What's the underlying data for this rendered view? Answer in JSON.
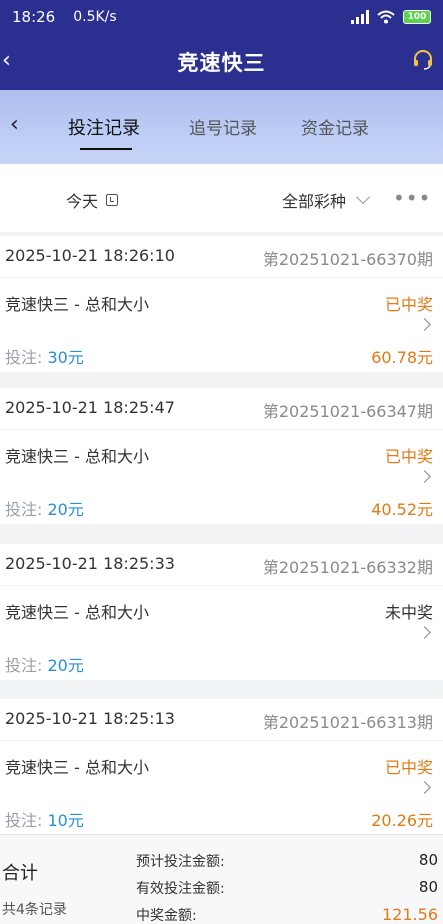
{
  "status_bar": {
    "time": "18:26",
    "net_speed": "0.5K/s",
    "battery": "100"
  },
  "app_bar": {
    "title": "竞速快三"
  },
  "tabs": [
    {
      "label": "投注记录",
      "active": true
    },
    {
      "label": "追号记录",
      "active": false
    },
    {
      "label": "资金记录",
      "active": false
    }
  ],
  "filter": {
    "date": "今天",
    "lottery": "全部彩种",
    "more": "•••"
  },
  "records": [
    {
      "datetime": "2025-10-21 18:26:10",
      "period": "第20251021-66370期",
      "name": "竞速快三 - 总和大小",
      "status": "已中奖",
      "bet_label": "投注:",
      "bet": "30元",
      "prize": "60.78元",
      "won": true
    },
    {
      "datetime": "2025-10-21 18:25:47",
      "period": "第20251021-66347期",
      "name": "竞速快三 - 总和大小",
      "status": "已中奖",
      "bet_label": "投注:",
      "bet": "20元",
      "prize": "40.52元",
      "won": true
    },
    {
      "datetime": "2025-10-21 18:25:33",
      "period": "第20251021-66332期",
      "name": "竞速快三 - 总和大小",
      "status": "未中奖",
      "bet_label": "投注:",
      "bet": "20元",
      "prize": "",
      "won": false
    },
    {
      "datetime": "2025-10-21 18:25:13",
      "period": "第20251021-66313期",
      "name": "竞速快三 - 总和大小",
      "status": "已中奖",
      "bet_label": "投注:",
      "bet": "10元",
      "prize": "20.26元",
      "won": true
    }
  ],
  "summary": {
    "total_label": "合计",
    "count": "共4条记录",
    "expected_label": "预计投注金额:",
    "expected_value": "80",
    "valid_label": "有效投注金额:",
    "valid_value": "80",
    "prize_label": "中奖金额:",
    "prize_value": "121.56"
  },
  "colors": {
    "header": "#2b2f8f",
    "win": "#e27a16",
    "amount": "#2a8fd8"
  }
}
